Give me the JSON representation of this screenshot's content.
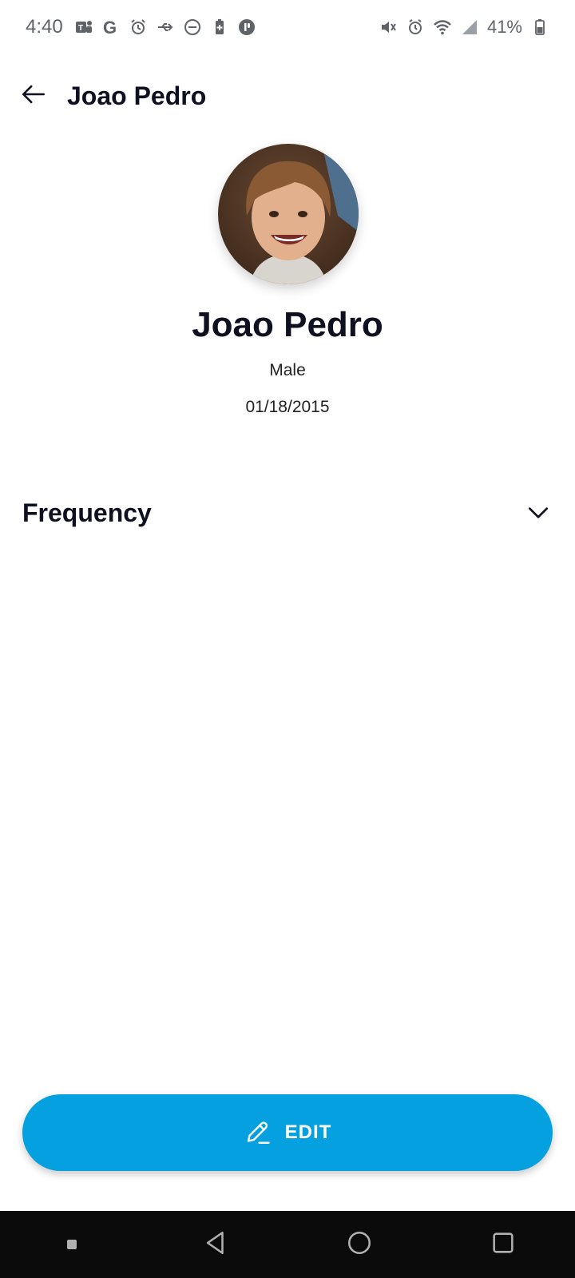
{
  "status_bar": {
    "time": "4:40",
    "battery": "41%",
    "left_icons": [
      "teams-icon",
      "google-icon",
      "alarm-snooze-icon",
      "usb-icon",
      "dnd-icon",
      "battery-saver-icon",
      "app-icon"
    ],
    "right_icons": [
      "vibrate-icon",
      "alarm-icon",
      "wifi-icon",
      "signal-icon",
      "battery-icon"
    ]
  },
  "header": {
    "back_icon": "arrow-left-icon",
    "title": "Joao Pedro"
  },
  "profile": {
    "name": "Joao Pedro",
    "gender": "Male",
    "dob": "01/18/2015"
  },
  "sections": {
    "frequency": {
      "title": "Frequency",
      "icon": "chevron-down-icon"
    }
  },
  "edit_button": {
    "label": "EDIT",
    "icon": "pencil-icon",
    "color": "#04a0e0"
  },
  "nav": {
    "items": [
      "dot-icon",
      "back-triangle-icon",
      "home-circle-icon",
      "recents-square-icon"
    ]
  }
}
